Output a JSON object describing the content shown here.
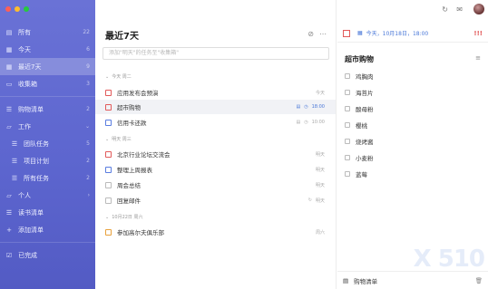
{
  "window": {
    "traffic_lights": [
      "#ff5f56",
      "#ffbd2e",
      "#27c93f"
    ]
  },
  "sidebar": {
    "items": [
      {
        "label": "所有",
        "count": "22",
        "icon": "inbox-icon"
      },
      {
        "label": "今天",
        "count": "6",
        "icon": "calendar-today-icon"
      },
      {
        "label": "最近7天",
        "count": "9",
        "icon": "calendar-week-icon"
      },
      {
        "label": "收集箱",
        "count": "3",
        "icon": "tray-icon"
      }
    ],
    "lists": [
      {
        "label": "购物清单",
        "count": "2",
        "icon": "list-icon"
      },
      {
        "label": "工作",
        "count": "",
        "icon": "folder-icon"
      },
      {
        "label": "团队任务",
        "count": "5",
        "icon": "list-icon"
      },
      {
        "label": "项目计划",
        "count": "2",
        "icon": "list-icon"
      },
      {
        "label": "所有任务",
        "count": "2",
        "icon": "list-icon"
      },
      {
        "label": "个人",
        "count": "",
        "icon": "folder-icon"
      },
      {
        "label": "读书清单",
        "count": "",
        "icon": "list-icon"
      },
      {
        "label": "添加清单",
        "count": "",
        "icon": "plus-icon"
      },
      {
        "label": "已完成",
        "count": "",
        "icon": "check-square-icon"
      }
    ]
  },
  "main": {
    "title": "最近7天",
    "add_placeholder": "添加\"明天\"的任务至\"收集箱\"",
    "groups": [
      {
        "label": "今天 周二"
      },
      {
        "label": "明天 周三"
      },
      {
        "label": "10月22日 周六"
      }
    ],
    "tasks": [
      {
        "title": "应用发布会预演",
        "meta": "今天",
        "color": "red"
      },
      {
        "title": "超市购物",
        "meta": "18:00",
        "color": "red"
      },
      {
        "title": "信用卡还款",
        "meta": "10:00",
        "color": "blue"
      },
      {
        "title": "北京行业论坛交流会",
        "meta": "明天",
        "color": "red"
      },
      {
        "title": "整理上周报表",
        "meta": "明天",
        "color": "blue"
      },
      {
        "title": "周会总结",
        "meta": "明天",
        "color": "gray"
      },
      {
        "title": "回复邮件",
        "meta": "明天",
        "color": "gray"
      },
      {
        "title": "参加高尔夫俱乐部",
        "meta": "周六",
        "color": "orange"
      }
    ]
  },
  "detail": {
    "date": "今天，10月18日，18:00",
    "priority": "!!!",
    "title": "超市购物",
    "subtasks": [
      "鸡胸肉",
      "海苔片",
      "酸母粉",
      "樱桃",
      "烧烤酱",
      "小麦粉",
      "蓝莓"
    ],
    "list_name": "购物清单"
  },
  "watermark": "X 510",
  "colors": {
    "accent": "#5d66cf",
    "priority": "#e25a5a"
  }
}
